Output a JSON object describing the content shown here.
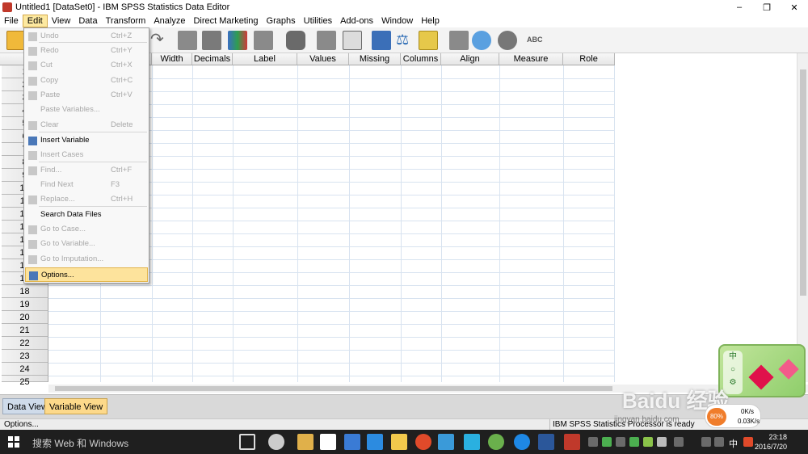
{
  "window": {
    "title": "Untitled1 [DataSet0] - IBM SPSS Statistics Data Editor",
    "minimize": "–",
    "restore": "❐",
    "close": "✕"
  },
  "menubar": [
    "File",
    "Edit",
    "View",
    "Data",
    "Transform",
    "Analyze",
    "Direct Marketing",
    "Graphs",
    "Utilities",
    "Add-ons",
    "Window",
    "Help"
  ],
  "edit_menu": {
    "items": [
      {
        "label": "Undo",
        "shortcut": "Ctrl+Z",
        "enabled": false,
        "icon": "undo-icon"
      },
      {
        "label": "Redo",
        "shortcut": "Ctrl+Y",
        "enabled": false,
        "icon": "redo-icon"
      },
      {
        "label": "Cut",
        "shortcut": "Ctrl+X",
        "enabled": false,
        "icon": "cut-icon"
      },
      {
        "label": "Copy",
        "shortcut": "Ctrl+C",
        "enabled": false,
        "icon": "copy-icon"
      },
      {
        "label": "Paste",
        "shortcut": "Ctrl+V",
        "enabled": false,
        "icon": "paste-icon"
      },
      {
        "label": "Paste Variables...",
        "shortcut": "",
        "enabled": false,
        "icon": ""
      },
      {
        "label": "Clear",
        "shortcut": "Delete",
        "enabled": false,
        "icon": "clear-icon"
      },
      {
        "label": "Insert Variable",
        "shortcut": "",
        "enabled": true,
        "icon": "insert-variable-icon"
      },
      {
        "label": "Insert Cases",
        "shortcut": "",
        "enabled": false,
        "icon": "insert-cases-icon"
      },
      {
        "label": "Find...",
        "shortcut": "Ctrl+F",
        "enabled": false,
        "icon": "find-icon"
      },
      {
        "label": "Find Next",
        "shortcut": "F3",
        "enabled": false,
        "icon": ""
      },
      {
        "label": "Replace...",
        "shortcut": "Ctrl+H",
        "enabled": false,
        "icon": "replace-icon"
      },
      {
        "label": "Search Data Files",
        "shortcut": "",
        "enabled": true,
        "icon": ""
      },
      {
        "label": "Go to Case...",
        "shortcut": "",
        "enabled": false,
        "icon": "go-to-case-icon"
      },
      {
        "label": "Go to Variable...",
        "shortcut": "",
        "enabled": false,
        "icon": "go-to-variable-icon"
      },
      {
        "label": "Go to Imputation...",
        "shortcut": "",
        "enabled": false,
        "icon": "go-to-imputation-icon"
      },
      {
        "label": "Options...",
        "shortcut": "",
        "enabled": true,
        "icon": "options-icon",
        "highlighted": true
      }
    ]
  },
  "columns": [
    "Width",
    "Decimals",
    "Label",
    "Values",
    "Missing",
    "Columns",
    "Align",
    "Measure",
    "Role"
  ],
  "rows": [
    "1",
    "2",
    "3",
    "4",
    "5",
    "6",
    "7",
    "8",
    "9",
    "10",
    "11",
    "12",
    "13",
    "14",
    "15",
    "16",
    "17",
    "18",
    "19",
    "20",
    "21",
    "22",
    "23",
    "24",
    "25"
  ],
  "tabs": {
    "data_view": "Data View",
    "variable_view": "Variable View"
  },
  "status": {
    "left": "Options...",
    "right": "IBM SPSS Statistics Processor is ready"
  },
  "taskbar": {
    "search": "搜索 Web 和 Windows",
    "time": "23:18",
    "date": "2016/7/20",
    "ime": "中"
  },
  "widget": {
    "zh": "中",
    "percent": "80%",
    "up": "0K/s",
    "down": "0.03K/s"
  },
  "watermark": {
    "main": "Baidu 经验",
    "sub": "jingyan.baidu.com"
  },
  "colors": {
    "menu_highlight": "#fde39c",
    "tab_active": "#fdd98a",
    "tab_inactive": "#cfdbea",
    "taskbar": "#1f1f1f"
  }
}
